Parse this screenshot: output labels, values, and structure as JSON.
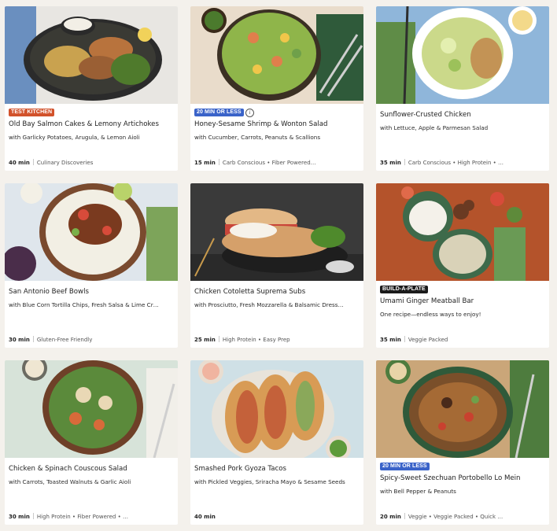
{
  "cards": [
    {
      "badge": "TEST KITCHEN",
      "title": "Old Bay Salmon Cakes & Lemony Artichokes",
      "subtitle": "with Garlicky Potatoes, Arugula, & Lemon Aioli",
      "time": "40 min",
      "tags": "Culinary Discoveries"
    },
    {
      "badge": "20 MIN OR LESS",
      "title": "Honey-Sesame Shrimp & Wonton Salad",
      "subtitle": "with Cucumber, Carrots, Peanuts & Scallions",
      "time": "15 min",
      "tags": "Carb Conscious • Fiber Powered…"
    },
    {
      "badge": "",
      "title": "Sunflower-Crusted Chicken",
      "subtitle": "with Lettuce, Apple & Parmesan Salad",
      "time": "35 min",
      "tags": "Carb Conscious • High Protein • …"
    },
    {
      "badge": "",
      "title": "San Antonio Beef Bowls",
      "subtitle": "with Blue Corn Tortilla Chips, Fresh Salsa & Lime Cr…",
      "time": "30 min",
      "tags": "Gluten-Free Friendly"
    },
    {
      "badge": "",
      "title": "Chicken Cotoletta Suprema Subs",
      "subtitle": "with Prosciutto, Fresh Mozzarella & Balsamic Dress…",
      "time": "25 min",
      "tags": "High Protein • Easy Prep"
    },
    {
      "badge": "BUILD-A-PLATE",
      "title": "Umami Ginger Meatball Bar",
      "subtitle": "One recipe—endless ways to enjoy!",
      "time": "35 min",
      "tags": "Veggie Packed"
    },
    {
      "badge": "",
      "title": "Chicken & Spinach Couscous Salad",
      "subtitle": "with Carrots, Toasted Walnuts & Garlic Aioli",
      "time": "30 min",
      "tags": "High Protein • Fiber Powered • …"
    },
    {
      "badge": "",
      "title": "Smashed Pork Gyoza Tacos",
      "subtitle": "with Pickled Veggies, Sriracha Mayo & Sesame Seeds",
      "time": "40 min",
      "tags": ""
    },
    {
      "badge": "20 MIN OR LESS",
      "title": "Spicy-Sweet Szechuan Portobello Lo Mein",
      "subtitle": "with Bell Pepper & Peanuts",
      "time": "20 min",
      "tags": "Veggie • Veggie Packed • Quick …"
    }
  ],
  "colors": {
    "test_kitchen": "#d2522b",
    "quick": "#3a63c9",
    "build": "#1b1b1b"
  }
}
